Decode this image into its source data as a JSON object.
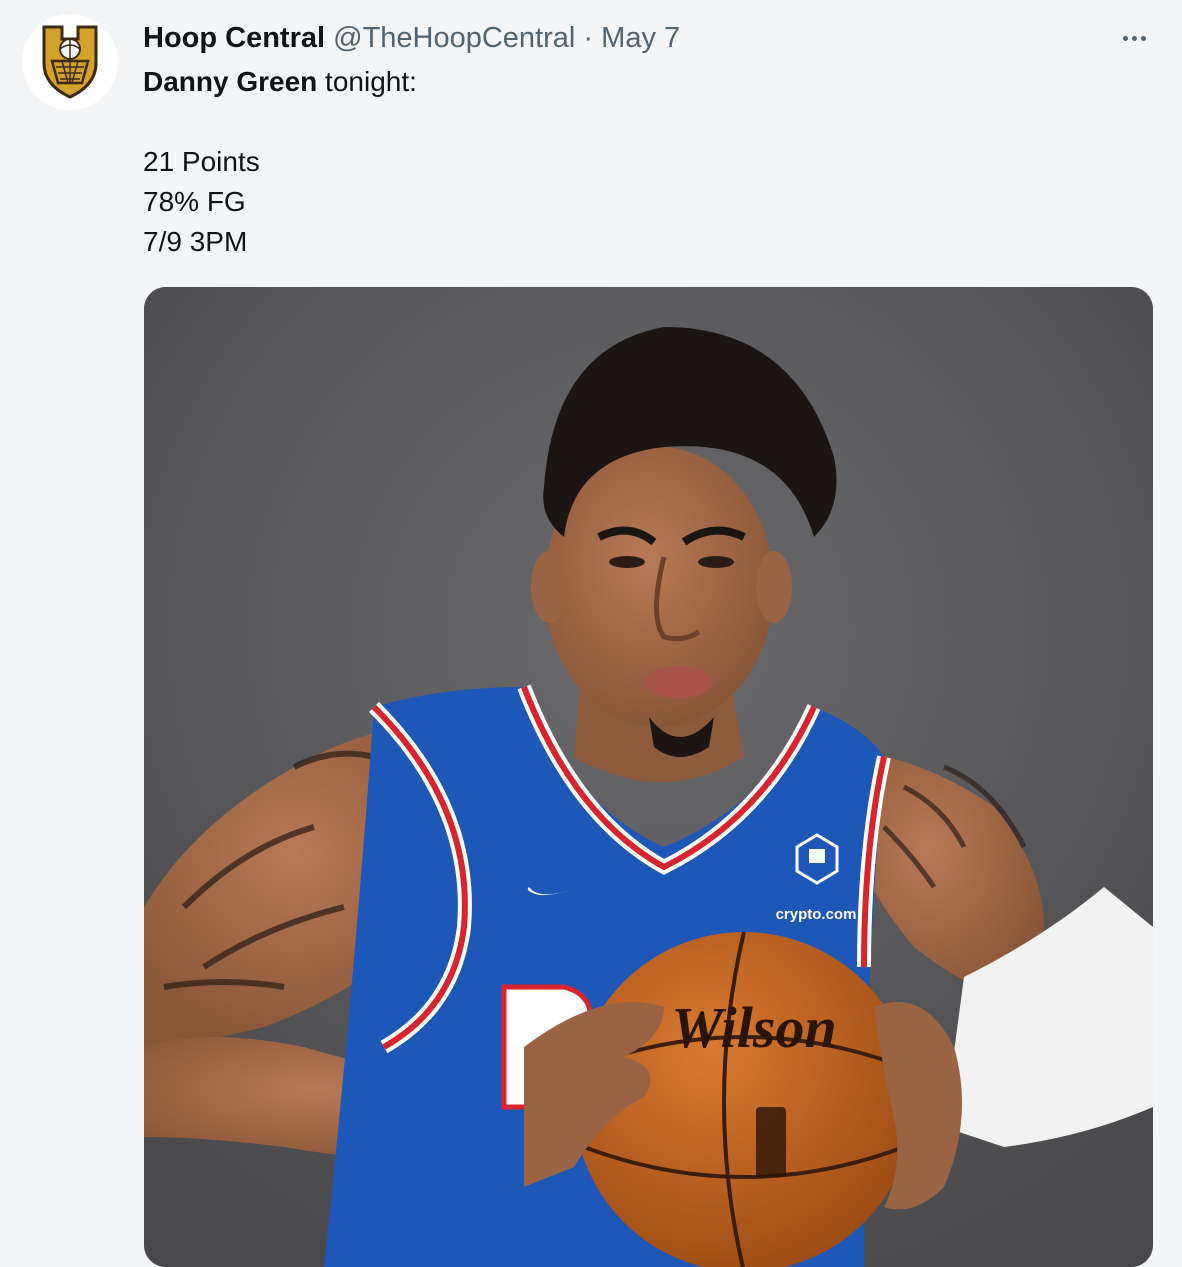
{
  "tweet": {
    "display_name": "Hoop Central",
    "handle": "@TheHoopCentral",
    "separator": "·",
    "date": "May 7",
    "more_icon": "more-horizontal-icon",
    "text": {
      "player_name": "Danny Green",
      "intro_rest": " tonight:",
      "stats": [
        "21 Points",
        "78% FG",
        "7/9 3PM"
      ]
    },
    "media": {
      "jersey_sponsor": "crypto.com",
      "ball_brand": "Wilson"
    }
  },
  "colors": {
    "background": "#f3f5f7",
    "primary_text": "#0f1419",
    "secondary_text": "#536471",
    "logo_gold": "#d4a22a",
    "logo_dark": "#3b2a14",
    "jersey_blue": "#1d57b8",
    "jersey_red": "#d9232e",
    "ball_orange": "#c8661f"
  }
}
